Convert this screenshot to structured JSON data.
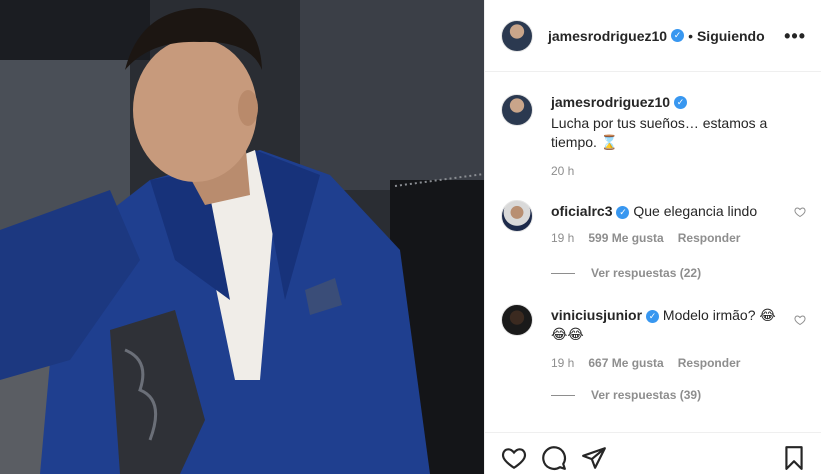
{
  "post": {
    "author": "jamesrodriguez10",
    "follow_status": "Siguiendo",
    "separator": "•",
    "more_label": "•••"
  },
  "caption": {
    "author": "jamesrodriguez10",
    "text": "Lucha por tus sueños… estamos a tiempo. ⌛",
    "time": "20 h"
  },
  "comments": [
    {
      "user": "oficialrc3",
      "text": "Que elegancia lindo",
      "time": "19 h",
      "likes": "599 Me gusta",
      "reply_label": "Responder",
      "view_replies": "Ver respuestas (22)"
    },
    {
      "user": "viniciusjunior",
      "text": "Modelo irmão? 😂 😂😂",
      "time": "19 h",
      "likes": "667 Me gusta",
      "reply_label": "Responder",
      "view_replies": "Ver respuestas (39)"
    }
  ],
  "icons": {
    "like": "heart-icon",
    "comment": "comment-icon",
    "share": "paper-plane-icon",
    "save": "bookmark-icon"
  },
  "colors": {
    "verified": "#3897f0",
    "suit": "#1f3f8f",
    "muted_text": "#8e8e8e"
  }
}
